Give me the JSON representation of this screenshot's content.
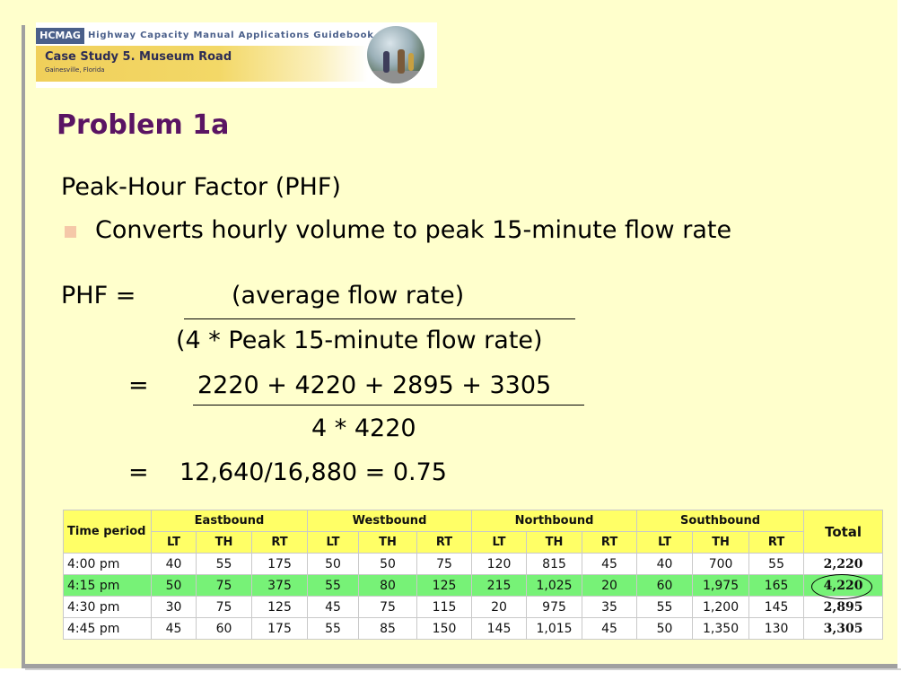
{
  "banner": {
    "badge": "HCMAG",
    "guidebook": "Highway Capacity Manual Applications Guidebook",
    "case_study": "Case Study 5. Museum Road",
    "location": "Gainesville, Florida"
  },
  "title": "Problem 1a",
  "heading": "Peak-Hour Factor (PHF)",
  "bullet": "Converts hourly volume to peak 15-minute flow rate",
  "formula": {
    "lhs": "PHF =",
    "numerator": "(average flow rate)",
    "denominator": "(4 * Peak 15-minute flow rate)",
    "eq1": "=",
    "numerator2": "2220 + 4220 + 2895 + 3305",
    "denominator2": "4 * 4220",
    "eq2": "=",
    "result": "12,640/16,880 = 0.75"
  },
  "table": {
    "headers": {
      "time_period": "Time period",
      "eastbound": "Eastbound",
      "westbound": "Westbound",
      "northbound": "Northbound",
      "southbound": "Southbound",
      "total": "Total",
      "movements": [
        "LT",
        "TH",
        "RT",
        "LT",
        "TH",
        "RT",
        "LT",
        "TH",
        "RT",
        "LT",
        "TH",
        "RT"
      ]
    },
    "rows": [
      {
        "time": "4:00 pm",
        "values": [
          "40",
          "55",
          "175",
          "50",
          "50",
          "75",
          "120",
          "815",
          "45",
          "40",
          "700",
          "55"
        ],
        "total": "2,220"
      },
      {
        "time": "4:15 pm",
        "values": [
          "50",
          "75",
          "375",
          "55",
          "80",
          "125",
          "215",
          "1,025",
          "20",
          "60",
          "1,975",
          "165"
        ],
        "total": "4,220"
      },
      {
        "time": "4:30 pm",
        "values": [
          "30",
          "75",
          "125",
          "45",
          "75",
          "115",
          "20",
          "975",
          "35",
          "55",
          "1,200",
          "145"
        ],
        "total": "2,895"
      },
      {
        "time": "4:45 pm",
        "values": [
          "45",
          "60",
          "175",
          "55",
          "85",
          "150",
          "145",
          "1,015",
          "45",
          "50",
          "1,350",
          "130"
        ],
        "total": "3,305"
      }
    ],
    "highlight_color": "#77f277",
    "header_color": "#ffff66"
  }
}
